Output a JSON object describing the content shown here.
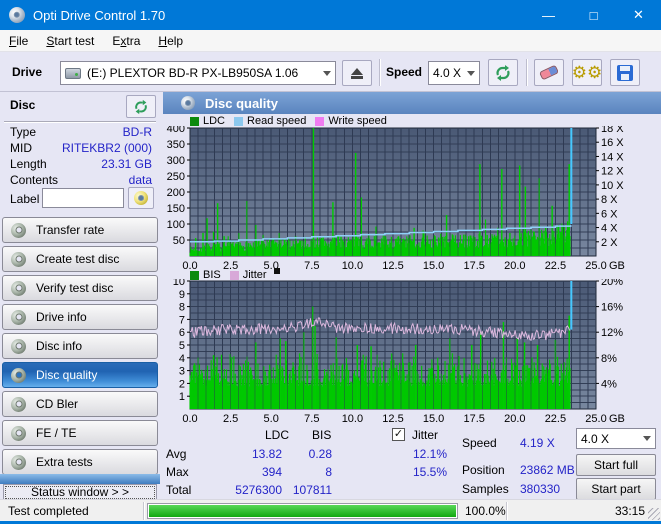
{
  "window": {
    "title": "Opti Drive Control 1.70",
    "minimize": "—",
    "maximize": "□",
    "close": "✕"
  },
  "menu": {
    "items": [
      {
        "label": "File",
        "accel": 0
      },
      {
        "label": "Start test",
        "accel": 0
      },
      {
        "label": "Extra",
        "accel": 1
      },
      {
        "label": "Help",
        "accel": 0
      }
    ]
  },
  "toolbar": {
    "drive_label": "Drive",
    "drive_value": "(E:)   PLEXTOR BD-R  PX-LB950SA 1.06",
    "speed_label": "Speed",
    "speed_value": "4.0 X"
  },
  "disc_panel": {
    "title": "Disc",
    "rows": [
      {
        "label": "Type",
        "value": "BD-R"
      },
      {
        "label": "MID",
        "value": "RITEKBR2 (000)"
      },
      {
        "label": "Length",
        "value": "23.31 GB"
      },
      {
        "label": "Contents",
        "value": "data"
      }
    ],
    "label_row": {
      "label": "Label",
      "value": ""
    }
  },
  "sidebar": {
    "buttons": [
      {
        "label": "Transfer rate"
      },
      {
        "label": "Create test disc"
      },
      {
        "label": "Verify test disc"
      },
      {
        "label": "Drive info"
      },
      {
        "label": "Disc info"
      },
      {
        "label": "Disc quality"
      },
      {
        "label": "CD Bler"
      },
      {
        "label": "FE / TE"
      },
      {
        "label": "Extra tests"
      }
    ],
    "active_index": 5,
    "status_window": "Status window > >"
  },
  "quality": {
    "header": "Disc quality",
    "stats": {
      "col_ldc": "LDC",
      "col_bis": "BIS",
      "col_jitter": "Jitter",
      "jitter_checked": "✓",
      "rows": [
        {
          "label": "Avg",
          "ldc": "13.82",
          "bis": "0.28",
          "jitter": "12.1%"
        },
        {
          "label": "Max",
          "ldc": "394",
          "bis": "8",
          "jitter": "15.5%"
        },
        {
          "label": "Total",
          "ldc": "5276300",
          "bis": "107811",
          "jitter": ""
        }
      ],
      "speed_label": "Speed",
      "speed_value": "4.19 X",
      "position_label": "Position",
      "position_value": "23862 MB",
      "samples_label": "Samples",
      "samples_value": "380330",
      "speed_select": "4.0 X",
      "start_full": "Start full",
      "start_part": "Start part"
    }
  },
  "statusbar": {
    "text": "Test completed",
    "percent": "100.0%",
    "time": "33:15"
  },
  "colors": {
    "titlebar": "#0078D7",
    "accent_green": "#00C800",
    "read_speed": "#8FD0F8",
    "jitter": "#DCB8DE",
    "write_speed": "#F07CF0",
    "value_blue": "#2424C8"
  },
  "chart_data": [
    {
      "type": "area",
      "title": "LDC errors and read speed vs disc position",
      "seed": 7,
      "xlim": [
        0,
        25
      ],
      "x_unit": "GB",
      "data_end": 23.45,
      "x_ticks": [
        "0.0",
        "2.5",
        "5.0",
        "7.5",
        "10.0",
        "12.5",
        "15.0",
        "17.5",
        "20.0",
        "22.5",
        "25.0"
      ],
      "left_axis": {
        "lim": [
          0,
          400
        ],
        "ticks": [
          {
            "v": 400,
            "t": "400"
          },
          {
            "v": 350,
            "t": "350"
          },
          {
            "v": 300,
            "t": "300"
          },
          {
            "v": 250,
            "t": "250"
          },
          {
            "v": 200,
            "t": "200"
          },
          {
            "v": 150,
            "t": "150"
          },
          {
            "v": 100,
            "t": "100"
          },
          {
            "v": 50,
            "t": "50"
          }
        ]
      },
      "right_axis": {
        "ticks": [
          {
            "v": 400,
            "t": "18 X"
          },
          {
            "v": 355.6,
            "t": "16 X"
          },
          {
            "v": 311.1,
            "t": "14 X"
          },
          {
            "v": 266.7,
            "t": "12 X"
          },
          {
            "v": 222.2,
            "t": "10 X"
          },
          {
            "v": 177.8,
            "t": "8 X"
          },
          {
            "v": 133.3,
            "t": "6 X"
          },
          {
            "v": 88.9,
            "t": "4 X"
          },
          {
            "v": 44.4,
            "t": "2 X"
          }
        ]
      },
      "grid": {
        "x_minor": 0.5,
        "y_minor": 25
      },
      "legend": [
        {
          "label": "LDC",
          "color": "#0C8A0C"
        },
        {
          "label": "Read speed",
          "color": "#8CC8EE"
        },
        {
          "label": "Write speed",
          "color": "#F07CF0"
        }
      ],
      "series": [
        {
          "name": "LDC noise",
          "type": "noise_bars",
          "color": "#00C800",
          "step": 0.05,
          "end": 23.42,
          "min": 5,
          "amp": [
            0.5,
            1.45
          ],
          "extra": {
            "p": 0.035,
            "mult": [
              1.4,
              2.2
            ]
          },
          "base": [
            [
              0,
              20
            ],
            [
              1,
              26
            ],
            [
              2.5,
              30
            ],
            [
              5,
              38
            ],
            [
              7.5,
              42
            ],
            [
              10,
              46
            ],
            [
              12.5,
              44
            ],
            [
              15,
              46
            ],
            [
              17.5,
              48
            ],
            [
              20,
              52
            ],
            [
              21.5,
              56
            ],
            [
              22.5,
              66
            ],
            [
              23,
              76
            ],
            [
              23.45,
              88
            ]
          ]
        },
        {
          "name": "LDC spikes",
          "type": "spikes",
          "color": "#00CC00",
          "points": [
            [
              0.35,
              56
            ],
            [
              0.8,
              72
            ],
            [
              1.05,
              118
            ],
            [
              1.45,
              76
            ],
            [
              1.7,
              165
            ],
            [
              2.1,
              62
            ],
            [
              3.0,
              72
            ],
            [
              3.5,
              172
            ],
            [
              4.05,
              97
            ],
            [
              4.5,
              66
            ],
            [
              5.5,
              72
            ],
            [
              6.5,
              62
            ],
            [
              7.6,
              400
            ],
            [
              8.2,
              62
            ],
            [
              8.8,
              168
            ],
            [
              9.3,
              60
            ],
            [
              10.2,
              322
            ],
            [
              10.55,
              183
            ],
            [
              11.0,
              66
            ],
            [
              12.0,
              62
            ],
            [
              13.8,
              88
            ],
            [
              14.4,
              76
            ],
            [
              15.45,
              70
            ],
            [
              15.8,
              128
            ],
            [
              17.0,
              62
            ],
            [
              17.85,
              287
            ],
            [
              18.3,
              66
            ],
            [
              19.2,
              272
            ],
            [
              19.7,
              72
            ],
            [
              20.3,
              283
            ],
            [
              20.65,
              217
            ],
            [
              21.0,
              82
            ],
            [
              21.5,
              243
            ],
            [
              21.9,
              92
            ],
            [
              22.3,
              157
            ],
            [
              22.7,
              97
            ],
            [
              23.35,
              287
            ]
          ]
        },
        {
          "name": "Read speed",
          "type": "step_line",
          "color": "#8FD0F8",
          "width": 1.5,
          "value_scale": 22.222,
          "points": [
            [
              0,
              2.0
            ],
            [
              1.5,
              2.1
            ],
            [
              3,
              2.25
            ],
            [
              4.5,
              2.4
            ],
            [
              6,
              2.55
            ],
            [
              7.5,
              2.7
            ],
            [
              9,
              2.85
            ],
            [
              10.5,
              3.0
            ],
            [
              12,
              3.15
            ],
            [
              13.5,
              3.3
            ],
            [
              15,
              3.45
            ],
            [
              16.5,
              3.6
            ],
            [
              18,
              3.75
            ],
            [
              19.5,
              3.9
            ],
            [
              21,
              4.05
            ],
            [
              22.5,
              4.2
            ],
            [
              23.45,
              4.35
            ]
          ]
        },
        {
          "name": "End of data",
          "type": "vline",
          "color": "#46C8FF",
          "x": 23.48,
          "from": 100,
          "to": 400,
          "width": 2
        }
      ]
    },
    {
      "type": "bar",
      "title": "BIS errors and jitter vs disc position",
      "seed": 13,
      "xlim": [
        0,
        25
      ],
      "x_unit": "GB",
      "data_end": 23.45,
      "x_ticks": [
        "0.0",
        "2.5",
        "5.0",
        "7.5",
        "10.0",
        "12.5",
        "15.0",
        "17.5",
        "20.0",
        "22.5",
        "25.0"
      ],
      "left_axis": {
        "lim": [
          0,
          10
        ],
        "ticks": [
          {
            "v": 10,
            "t": "10"
          },
          {
            "v": 9,
            "t": "9"
          },
          {
            "v": 8,
            "t": "8"
          },
          {
            "v": 7,
            "t": "7"
          },
          {
            "v": 6,
            "t": "6"
          },
          {
            "v": 5,
            "t": "5"
          },
          {
            "v": 4,
            "t": "4"
          },
          {
            "v": 3,
            "t": "3"
          },
          {
            "v": 2,
            "t": "2"
          },
          {
            "v": 1,
            "t": "1"
          }
        ]
      },
      "right_axis": {
        "ticks": [
          {
            "v": 10,
            "t": "20%"
          },
          {
            "v": 8,
            "t": "16%"
          },
          {
            "v": 6,
            "t": "12%"
          },
          {
            "v": 4,
            "t": "8%"
          },
          {
            "v": 2,
            "t": "4%"
          }
        ]
      },
      "grid": {
        "x_minor": 0.5,
        "y_minor": 0.5
      },
      "legend": [
        {
          "label": "BIS",
          "color": "#0C8A0C"
        },
        {
          "label": "Jitter",
          "color": "#D8A8D8"
        }
      ],
      "series": [
        {
          "name": "BIS bars",
          "type": "noise_bars",
          "color": "#00C800",
          "step": 0.045,
          "end": 23.42,
          "min": 1.6,
          "clamp": 4.35,
          "amp": [
            0.85,
            1.15
          ],
          "extra": {
            "p": 0.5,
            "mult": [
              1.2,
              1.95
            ]
          },
          "base": [
            [
              0,
              2.05
            ],
            [
              23.45,
              2.05
            ]
          ]
        },
        {
          "name": "BIS spikes",
          "type": "spikes",
          "color": "#00CC00",
          "points": [
            [
              4.05,
              5.2
            ],
            [
              5.55,
              5.5
            ],
            [
              5.9,
              5.3
            ],
            [
              7.0,
              6.0
            ],
            [
              7.55,
              8.0
            ],
            [
              7.7,
              6.5
            ],
            [
              9.0,
              5.6
            ],
            [
              10.3,
              5.0
            ],
            [
              11.15,
              4.9
            ],
            [
              13.9,
              5.0
            ],
            [
              16.0,
              5.5
            ],
            [
              17.35,
              5.0
            ],
            [
              17.9,
              6.0
            ],
            [
              19.3,
              6.8
            ],
            [
              20.15,
              5.5
            ],
            [
              20.6,
              5.2
            ],
            [
              21.4,
              5.0
            ],
            [
              22.5,
              5.4
            ],
            [
              23.35,
              7.3
            ]
          ]
        },
        {
          "name": "Jitter",
          "type": "noise_line",
          "color": "#DCB8DE",
          "width": 1,
          "step": 0.07,
          "end": 23.45,
          "amp": 0.85,
          "base": [
            [
              0,
              6.0
            ],
            [
              2,
              6.2
            ],
            [
              5,
              6.25
            ],
            [
              7,
              6.5
            ],
            [
              7.6,
              6.9
            ],
            [
              9,
              6.3
            ],
            [
              12,
              6.3
            ],
            [
              15,
              6.25
            ],
            [
              17,
              6.2
            ],
            [
              18.5,
              6.0
            ],
            [
              20,
              5.9
            ],
            [
              21,
              5.8
            ],
            [
              22,
              5.8
            ],
            [
              23,
              5.95
            ],
            [
              23.45,
              6.3
            ]
          ]
        },
        {
          "name": "End of data",
          "type": "vline",
          "color": "#46C8FF",
          "x": 23.48,
          "from": 6.2,
          "to": 10,
          "width": 2
        }
      ]
    }
  ]
}
